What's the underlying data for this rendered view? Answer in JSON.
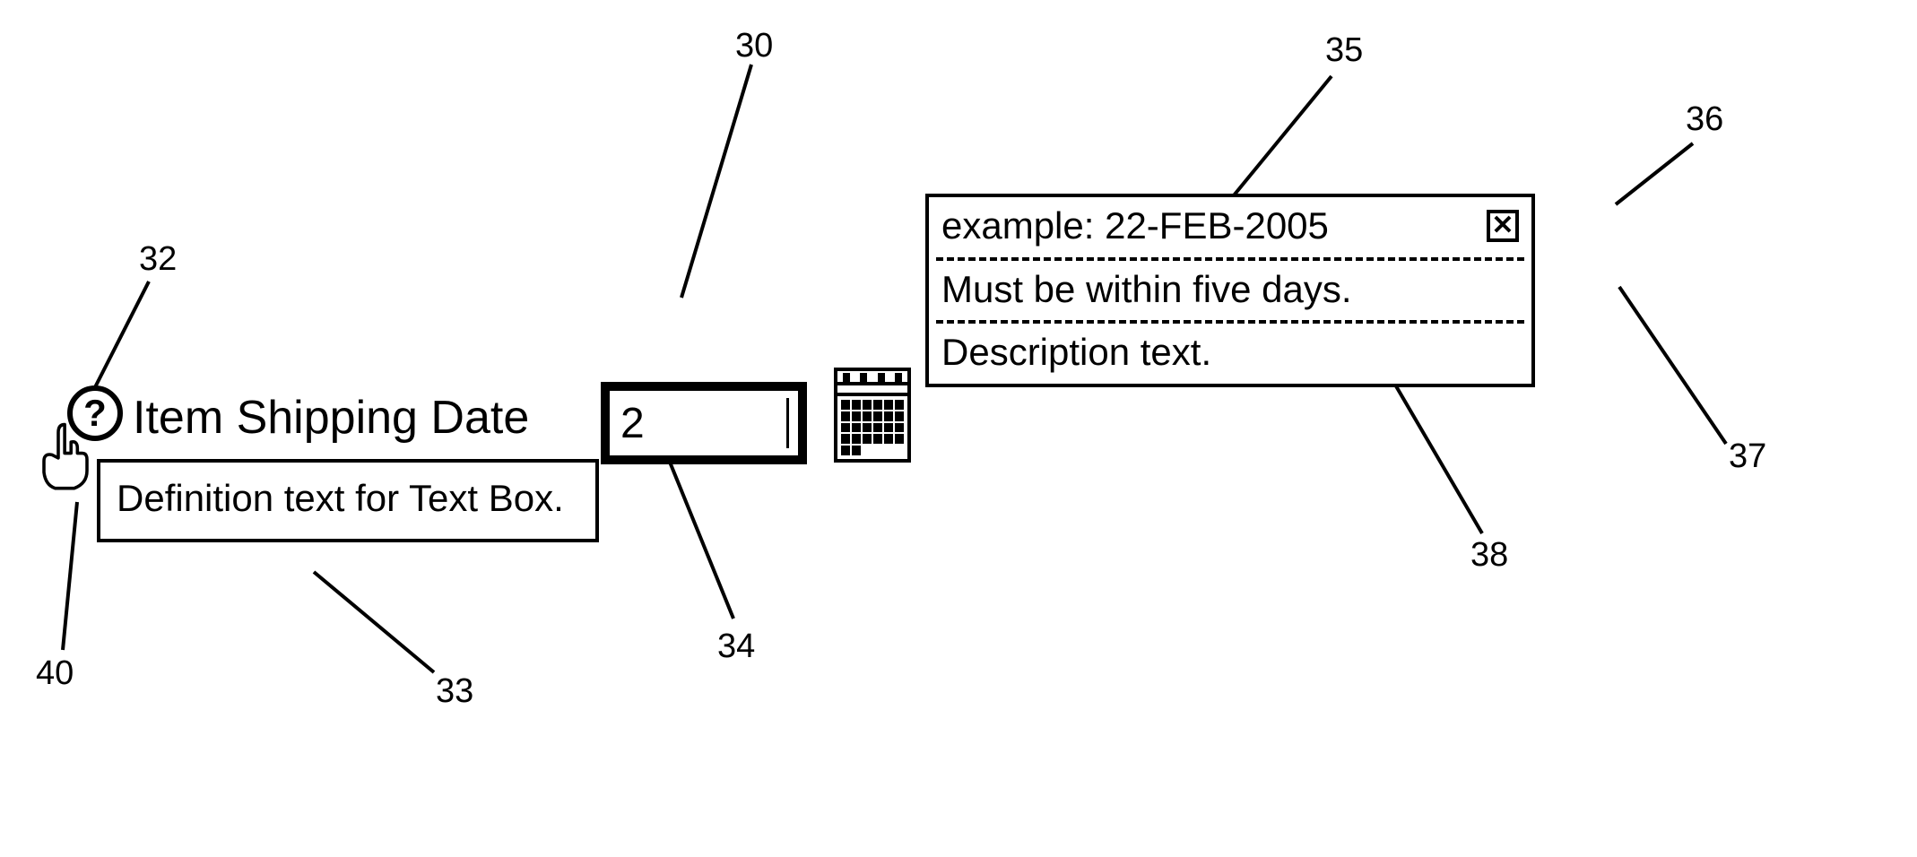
{
  "refs": {
    "r30": "30",
    "r32": "32",
    "r33": "33",
    "r34": "34",
    "r35": "35",
    "r36": "36",
    "r37": "37",
    "r38": "38",
    "r40": "40"
  },
  "help": {
    "glyph": "?"
  },
  "label": "Item Shipping Date",
  "definition": "Definition text for Text Box.",
  "input": {
    "value": "2"
  },
  "assist": {
    "example": "example: 22-FEB-2005",
    "close_glyph": "✕",
    "constraint": "Must be within five days.",
    "description": "Description text."
  }
}
